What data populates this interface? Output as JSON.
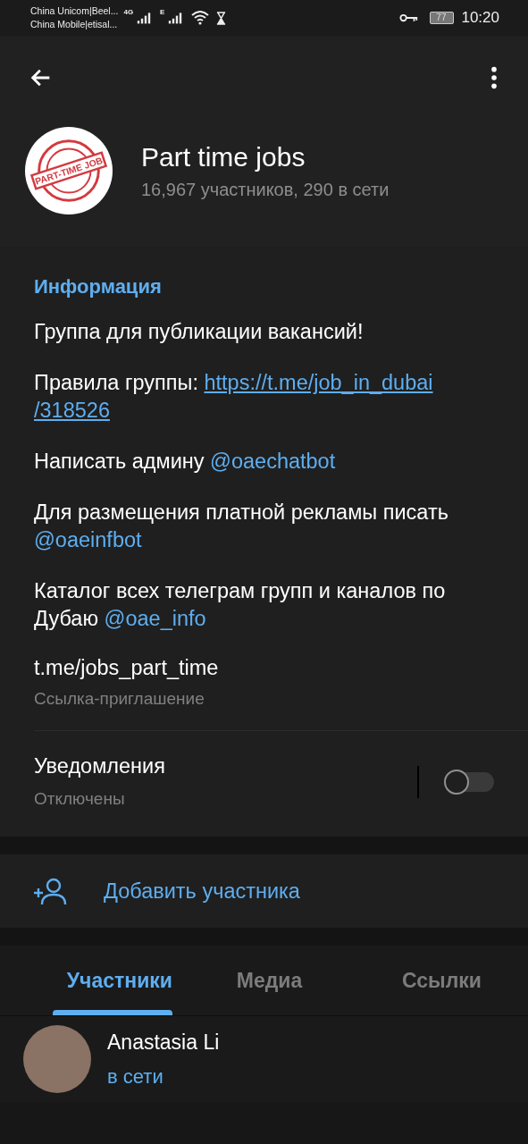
{
  "status_bar": {
    "carrier_1": "China Unicom|Beel...",
    "carrier_2": "China Mobile|etisal...",
    "network_1": "4G",
    "network_2": "E",
    "battery": "77",
    "time": "10:20"
  },
  "header": {
    "title": "Part time jobs",
    "subtitle": "16,967 участников, 290 в сети",
    "logo_text": "PART-TIME JOB"
  },
  "info": {
    "heading": "Информация",
    "paragraphs": [
      [
        {
          "kind": "text",
          "text": "Группа для публикации вакансий!"
        }
      ],
      [
        {
          "kind": "text",
          "text": "Правила группы: "
        },
        {
          "kind": "url",
          "text": "https://t.me/job_in_dubai"
        },
        {
          "kind": "break"
        },
        {
          "kind": "url",
          "text": "/318526"
        }
      ],
      [
        {
          "kind": "text",
          "text": "Написать админу "
        },
        {
          "kind": "mention",
          "text": "@oaechatbot"
        }
      ],
      [
        {
          "kind": "text",
          "text": "Для размещения платной рекламы писать "
        },
        {
          "kind": "mention",
          "text": "@oaeinfbot"
        }
      ],
      [
        {
          "kind": "text",
          "text": "Каталог всех телеграм групп и каналов по Дубаю "
        },
        {
          "kind": "mention",
          "text": "@oae_info"
        }
      ]
    ],
    "invite_link": "t.me/jobs_part_time",
    "invite_caption": "Ссылка-приглашение"
  },
  "notifications": {
    "label": "Уведомления",
    "status": "Отключены",
    "on": false
  },
  "add_member": "Добавить участника",
  "tabs": [
    {
      "label": "Участники",
      "selected": true
    },
    {
      "label": "Медиа",
      "selected": false
    },
    {
      "label": "Ссылки",
      "selected": false
    }
  ],
  "members": [
    {
      "name": "Anastasia Li",
      "status": "в сети",
      "online": true
    }
  ]
}
